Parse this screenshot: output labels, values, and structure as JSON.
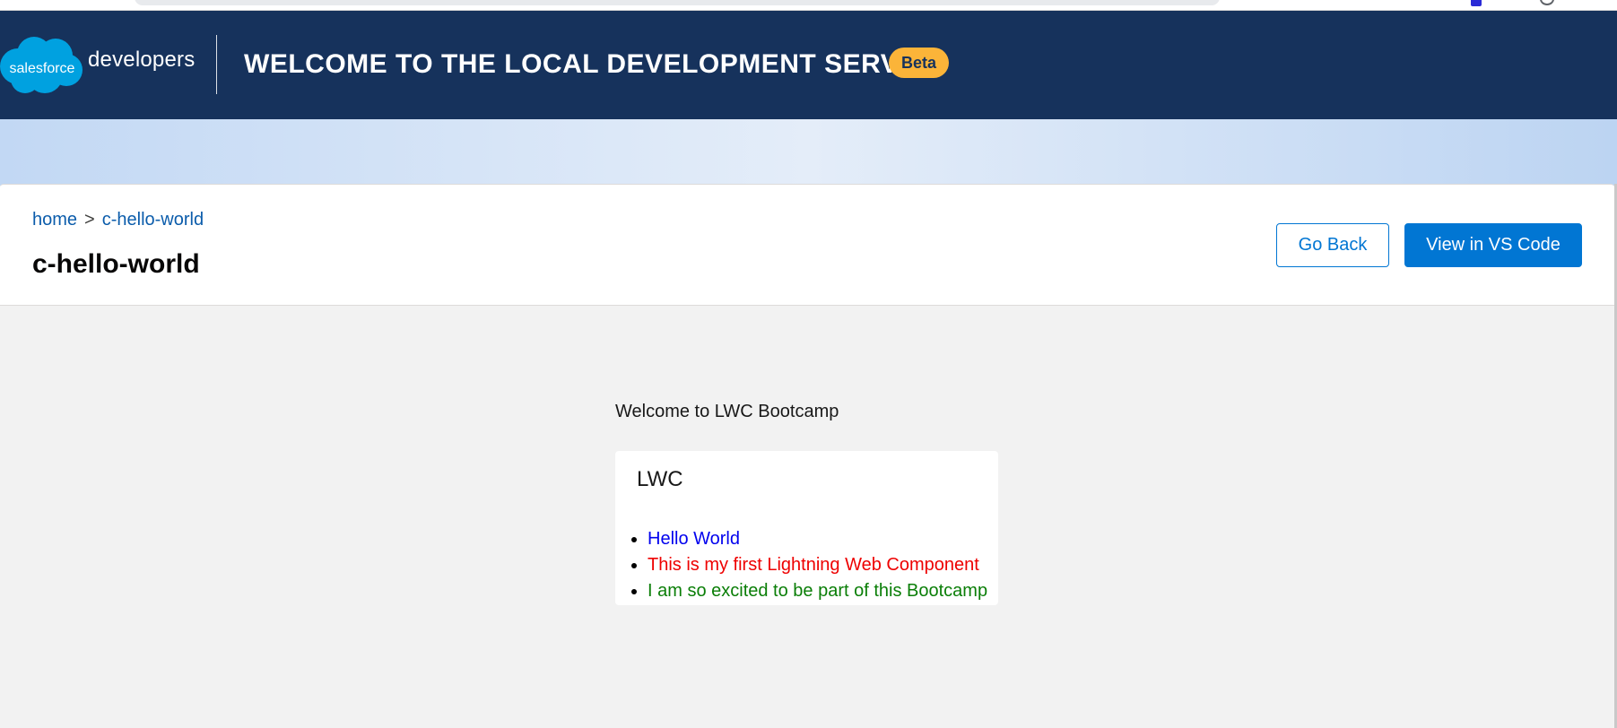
{
  "header": {
    "logo_cloud_text": "salesforce",
    "logo_text": "developers",
    "title": "WELCOME TO THE LOCAL DEVELOPMENT SERVER",
    "badge": "Beta"
  },
  "breadcrumb": {
    "home": "home",
    "separator": ">",
    "current": "c-hello-world"
  },
  "page": {
    "title": "c-hello-world",
    "go_back_label": "Go Back",
    "view_in_vscode_label": "View in VS Code"
  },
  "content": {
    "welcome": "Welcome to LWC Bootcamp",
    "card": {
      "title": "LWC",
      "items": [
        "Hello World",
        "This is my first Lightning Web Component",
        "I am so excited to be part of this Bootcamp"
      ]
    }
  },
  "colors": {
    "header_bg": "#16325c",
    "brand_blue": "#0176d3",
    "badge_bg": "#fbb439",
    "content_bg": "#f2f2f2",
    "item_blue": "#0000ee",
    "item_red": "#ee0000",
    "item_green": "#0a7e07"
  },
  "icons": {
    "logo": "salesforce-cloud-logo",
    "browser_extension": "extension-icon",
    "browser_profile": "profile-icon"
  }
}
